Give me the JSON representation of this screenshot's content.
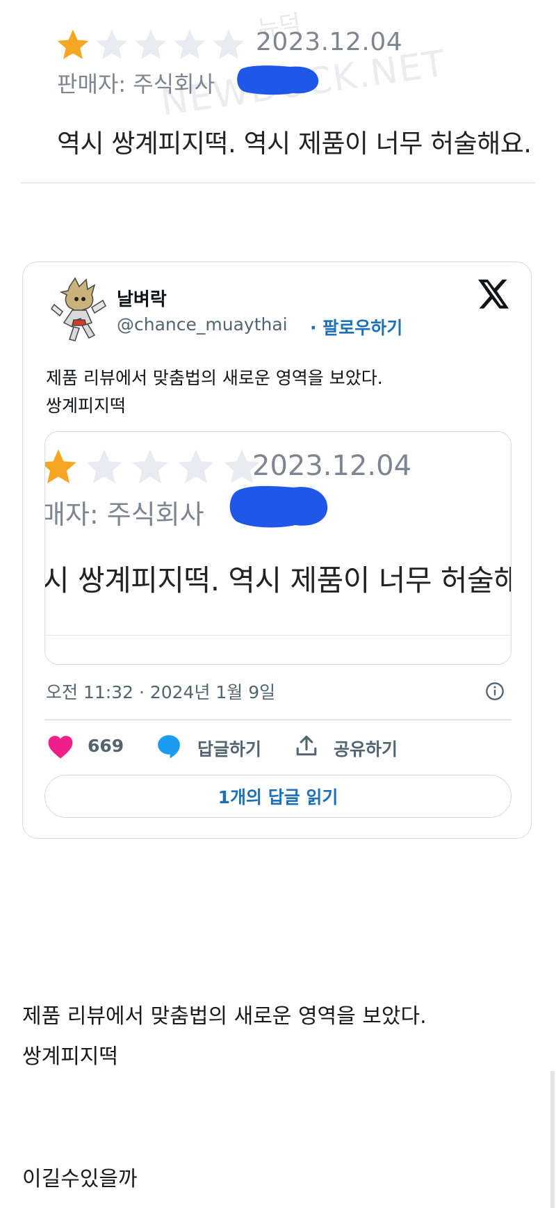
{
  "review": {
    "rating": 1,
    "max_rating": 5,
    "date": "2023.12.04",
    "seller": "판매자: 주식회사",
    "text": "역시 쌍계피지떡. 역시 제품이 너무 허술해요.",
    "watermark_top": "뉴덕",
    "watermark": "NEWDUCK.NET"
  },
  "tweet": {
    "author_name": "날벼락",
    "handle": "@chance_muaythai",
    "follow_label": "· 팔로우하기",
    "text_line1": "제품 리뷰에서 맞춤법의 새로운 영역을 보았다.",
    "text_line2": "쌍계피지떡",
    "media": {
      "date": "2023.12.04",
      "seller": "매자: 주식회사",
      "text": "시 쌍계피지떡. 역시 제품이 너무 허술해요"
    },
    "timestamp": "오전 11:32 · 2024년 1월 9일",
    "likes": "669",
    "reply_label": "답글하기",
    "share_label": "공유하기",
    "read_replies_label": "1개의 답글 읽기"
  },
  "post": {
    "line1": "제품 리뷰에서 맞춤법의 새로운 영역을 보았다.",
    "line2": "쌍계피지떡",
    "line3": "이길수있을까"
  },
  "colors": {
    "star_filled": "#f5a623",
    "star_empty": "#e8ebef",
    "redaction_blue": "#1f57e8",
    "link_blue": "#1d6fb8",
    "heart_pink": "#f0208a",
    "reply_blue": "#1d9bf0"
  },
  "icons": [
    "star-icon",
    "x-logo-icon",
    "info-icon",
    "heart-icon",
    "reply-icon",
    "share-icon"
  ]
}
